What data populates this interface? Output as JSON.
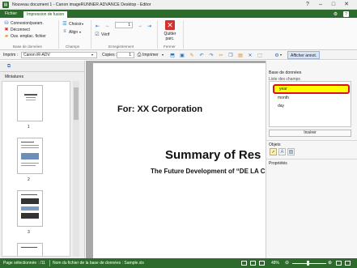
{
  "window": {
    "title": "Nouveau document 1 - Canon imageRUNNER ADVANCE Desktop - Editor",
    "controls": {
      "help": "?",
      "minimize": "–",
      "maximize": "□",
      "close": "✕"
    }
  },
  "ribbon_tabs": [
    "Fichier",
    "Impression de fusion"
  ],
  "ribbon": {
    "database_group": {
      "items": [
        "Connexion/param.",
        "Déconnect",
        "Ouv. emplac. fichier"
      ],
      "label": "Base de données"
    },
    "fields_group": {
      "items": [
        "Choisir",
        "Align"
      ],
      "label": "Champs"
    },
    "record_group": {
      "page_value": "1",
      "verify_label": "Vérif",
      "label": "Enregistrement"
    },
    "close_group": {
      "button_label": "Quitter\nparc.",
      "label": "Fermer"
    }
  },
  "toolbar2": {
    "printer_label": "Imprim :",
    "printer_value": "Canon iR-ADV",
    "copies_label": "Copies :",
    "copies_value": "1",
    "print_label": "Imprimer",
    "annot_label": "Afficher annot."
  },
  "thumbnails": {
    "title": "Miniatures",
    "pages": [
      "1",
      "2",
      "3"
    ]
  },
  "document": {
    "for_line": "For: XX Corporation",
    "summary": "Summary of Res",
    "subtitle": "The Future Development of “DE LA C"
  },
  "right_panel": {
    "db_title": "Base de données",
    "field_list_label": "Liste des champs",
    "fields": [
      "year",
      "month",
      "day"
    ],
    "insert_button": "Insérer",
    "objects_label": "Objets",
    "properties_label": "Propriétés"
  },
  "status": {
    "page_selected": "Page sélectionnée : /11",
    "db_file_name": "Nom du fichier de la base de données : Sample.xls",
    "zoom": "48%"
  },
  "colors": {
    "brand_green": "#2d6b2d",
    "highlight_yellow": "#ffff00",
    "highlight_border": "#e01010"
  }
}
